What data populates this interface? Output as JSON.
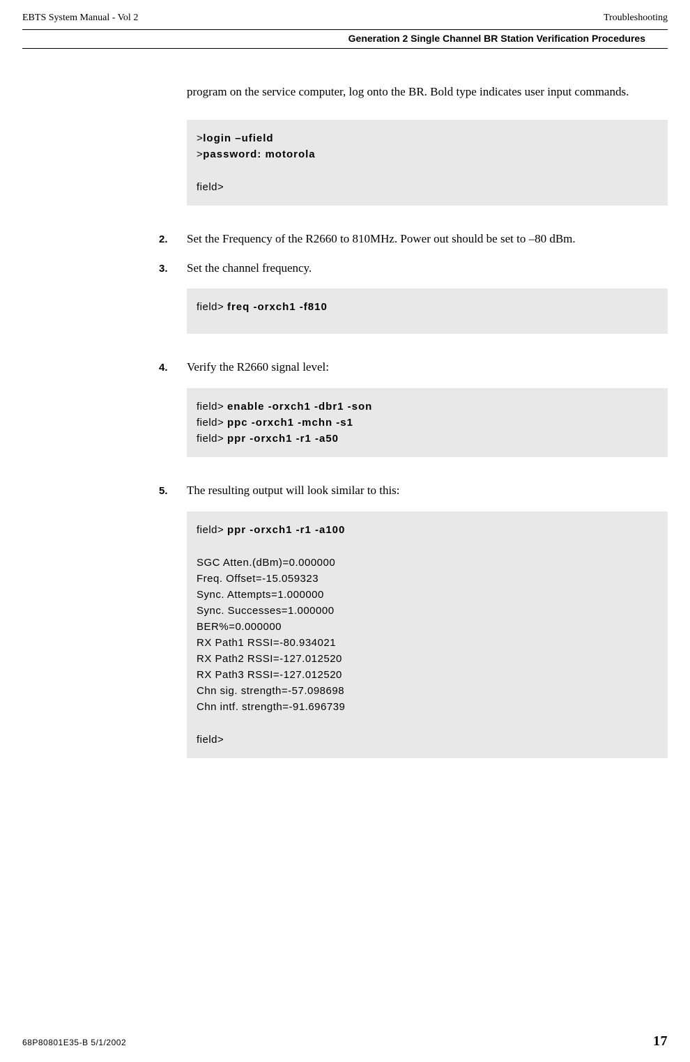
{
  "header": {
    "left": "EBTS System Manual - Vol 2",
    "right": "Troubleshooting",
    "sub": "Generation 2 Single Channel BR Station Verification Procedures"
  },
  "intro": "program on the service computer, log onto the BR. Bold type indicates user input commands.",
  "code1": {
    "p1a": ">",
    "p1b": "login –ufield",
    "p2a": ">",
    "p2b": "password: motorola",
    "p3": "field>"
  },
  "step2": {
    "num": "2.",
    "text": "Set the Frequency of the R2660 to 810MHz. Power out should be set to –80 dBm."
  },
  "step3": {
    "num": "3.",
    "text": "Set the channel frequency."
  },
  "code2": {
    "p1a": "field> ",
    "p1b": "freq -orxch1 -f810"
  },
  "step4": {
    "num": "4.",
    "text": "Verify the R2660 signal level:"
  },
  "code3": {
    "l1a": "field> ",
    "l1b": "enable -orxch1 -dbr1 -son",
    "l2a": "field> ",
    "l2b": "ppc -orxch1 -mchn -s1",
    "l3a": "field> ",
    "l3b": "ppr -orxch1 -r1 -a50"
  },
  "step5": {
    "num": "5.",
    "text": "The resulting output will look similar to this:"
  },
  "code4": {
    "l1a": "field> ",
    "l1b": "ppr -orxch1 -r1 -a100",
    "l2": "SGC Atten.(dBm)=0.000000",
    "l3": "Freq. Offset=-15.059323",
    "l4": "Sync. Attempts=1.000000",
    "l5": "Sync. Successes=1.000000",
    "l6": "BER%=0.000000",
    "l7": "RX Path1 RSSI=-80.934021",
    "l8": "RX Path2 RSSI=-127.012520",
    "l9": "RX Path3 RSSI=-127.012520",
    "l10": "Chn sig. strength=-57.098698",
    "l11": "Chn intf. strength=-91.696739",
    "l12": "field>"
  },
  "footer": {
    "left": "68P80801E35-B   5/1/2002",
    "page": "17"
  }
}
